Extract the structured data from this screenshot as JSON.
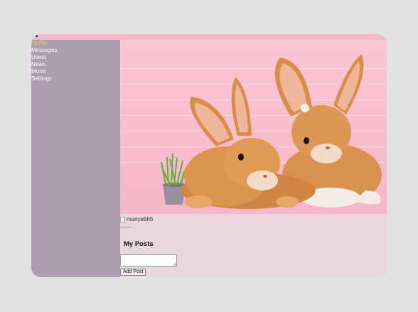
{
  "nav": {
    "items": [
      {
        "label": "Profile",
        "active": true
      },
      {
        "label": "Messages",
        "active": false
      },
      {
        "label": "Users",
        "active": false
      },
      {
        "label": "News",
        "active": false
      },
      {
        "label": "Music",
        "active": false
      },
      {
        "label": "Settings",
        "active": false
      }
    ]
  },
  "profile": {
    "avatar_alt": "mariya5h5",
    "description": "-----"
  },
  "posts": {
    "title": "My Posts",
    "input_value": "",
    "add_button_label": "Add Post"
  },
  "colors": {
    "sidebar": "#ae9cb1",
    "active_nav": "#f0c94c",
    "content_bg": "#e8d7de",
    "banner_bg": "#f6b6c8"
  },
  "icons": {
    "broken_image": "broken-image-icon"
  }
}
